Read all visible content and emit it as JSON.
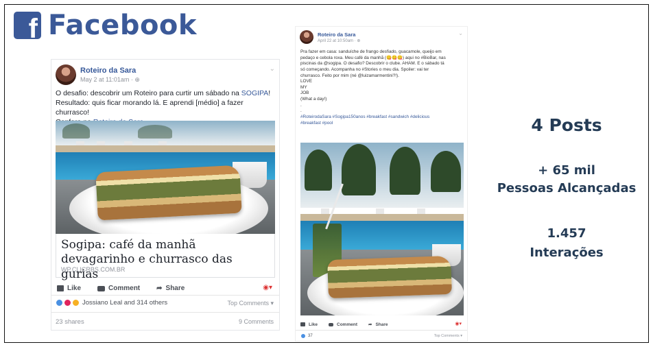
{
  "brand": {
    "logo_letter": "f",
    "title": "Facebook",
    "color": "#3b5998"
  },
  "post1": {
    "page_name": "Roteiro da Sara",
    "time": "May 2 at 11:01am · ⊕",
    "text_lines": [
      [
        "O desafio: descobrir um Roteiro para curtir um sábado na ",
        "SOGIPA",
        "!"
      ],
      [
        "Resultado: quis ficar morando lá. E aprendi [médio] a fazer churrasco!"
      ],
      [
        "Confere no ",
        "Roteiro da Sara",
        ""
      ]
    ],
    "link_title": "Sogipa: café da manhã devagarinho e churrasco das gurias",
    "link_source": "WP.CLICRBS.COM.BR",
    "like_label": "Like",
    "comment_label": "Comment",
    "share_label": "Share",
    "reactions_text": "Jossiano Leal and 314 others",
    "top_comments": "Top Comments ▾",
    "shares": "23 shares",
    "comments_count": "9 Comments"
  },
  "post2": {
    "page_name": "Roteiro da Sara",
    "time": "April 22 at 10:50am · ⊕",
    "lines": [
      "Pra fazer em casa: sanduíche de frango desfiado, guacamole, queijo em",
      "pedaço e cebola roxa. Meu café da manhã (😋😋😋) aqui no #BioBar, nas",
      "piscinas da @sogipa. O desafio? Descobrir o clube. AHAM. E o sábado tá",
      "só começando. Acompanha no #Stories o meu dia. Spoiler: vai ter",
      "churrasco. Feito por mim (né @luizamarmentini?!).",
      "LOVE",
      "MY",
      "JOB",
      "(What a day!)",
      ".",
      ".",
      "#RoteirodaSara #Sogipa150anos #breakfast #sandwich #delicious",
      "#breakfast #pool"
    ],
    "like_label": "Like",
    "comment_label": "Comment",
    "share_label": "Share",
    "reactions_count": "37",
    "top_comments": "Top Comments ▾"
  },
  "stats": {
    "posts": "4 Posts",
    "reach_value": "+ 65 mil",
    "reach_label": "Pessoas Alcançadas",
    "interactions_value": "1.457",
    "interactions_label": "Interações"
  },
  "icons": [
    "facebook-logo-icon",
    "globe-icon",
    "chevron-down-icon",
    "like-icon",
    "comment-icon",
    "share-icon",
    "reaction-icons"
  ]
}
